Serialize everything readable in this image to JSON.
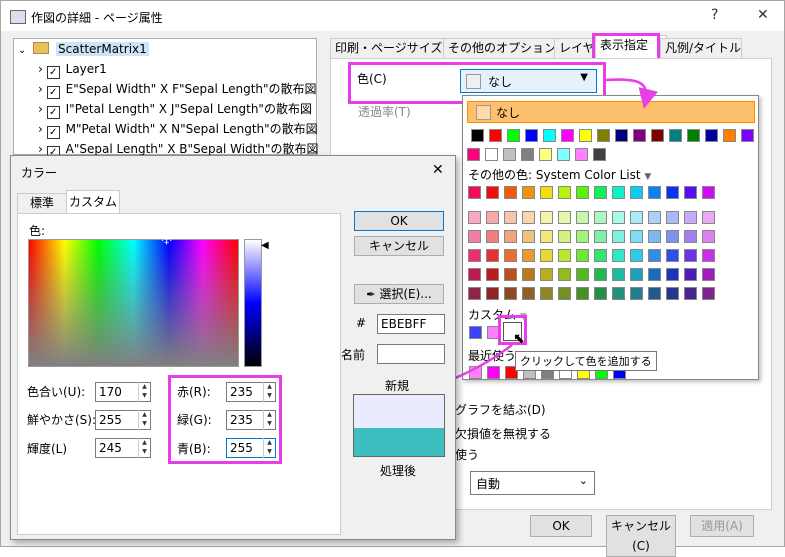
{
  "window": {
    "title": "作図の詳細 - ページ属性",
    "help": "?",
    "close": "✕"
  },
  "tree": {
    "root": "ScatterMatrix1",
    "items": [
      "Layer1",
      "E\"Sepal Width\" X F\"Sepal Length\"の散布図",
      "I\"Petal Length\" X J\"Sepal Length\"の散布図",
      "M\"Petal Width\" X N\"Sepal Length\"の散布図",
      "A\"Sepal Length\" X B\"Sepal Width\"の散布図"
    ]
  },
  "tabs": [
    "印刷・ページサイズ",
    "その他のオプション",
    "レイヤ",
    "表示指定",
    "凡例/タイトル"
  ],
  "display": {
    "color_label": "色(C)",
    "color_value": "なし",
    "transparency_label": "透過率(T)",
    "connect_label": "グラフを結ぶ(D)",
    "missing_label": "欠損値を無視する",
    "use_label": "使う",
    "auto_value": "自動"
  },
  "popup": {
    "none_label": "なし",
    "other_colors": "その他の色: System Color List",
    "custom_label": "カスタム",
    "recent_label": "最近使う",
    "tooltip": "クリックして色を追加する",
    "basic_colors": [
      "#000000",
      "#ff0000",
      "#00ff00",
      "#0000ff",
      "#00ffff",
      "#ff00ff",
      "#ffff00",
      "#808000",
      "#000080",
      "#800080",
      "#800000",
      "#008080",
      "#008000",
      "#0000a0",
      "#ff8000",
      "#8000ff"
    ],
    "basic_colors2": [
      "#ff0080",
      "#ffffff",
      "#c0c0c0",
      "#808080",
      "#ffff80",
      "#80ffff",
      "#ff80ff",
      "#404040"
    ],
    "custom_colors": [
      "#4040ff",
      "#ff80ff",
      "#ffffff"
    ],
    "recent_colors": [
      "#ff80ff",
      "#ff00ff",
      "#ff0000",
      "#c0c0c0",
      "#808080",
      "#ffffff",
      "#ffff00",
      "#00ff00",
      "#0000ff"
    ]
  },
  "color_dialog": {
    "title": "カラー",
    "close": "✕",
    "tab_standard": "標準",
    "tab_custom": "カスタム",
    "color_label": "色:",
    "ok": "OK",
    "cancel": "キャンセル",
    "pick": "選択(E)...",
    "hash": "#",
    "hex": "EBEBFF",
    "name_label": "名前",
    "new_label": "新規",
    "current_label": "処理後",
    "hue_label": "色合い(U):",
    "hue": "170",
    "sat_label": "鮮やかさ(S):",
    "sat": "255",
    "lum_label": "輝度(L)",
    "lum": "245",
    "red_label": "赤(R):",
    "red": "235",
    "green_label": "緑(G):",
    "green": "235",
    "blue_label": "青(B):",
    "blue": "255",
    "new_color": "#EBEBFF",
    "current_color": "#3dbfbf"
  },
  "footer": {
    "ok": "OK",
    "cancel": "キャンセル(C)",
    "apply": "適用(A)"
  }
}
